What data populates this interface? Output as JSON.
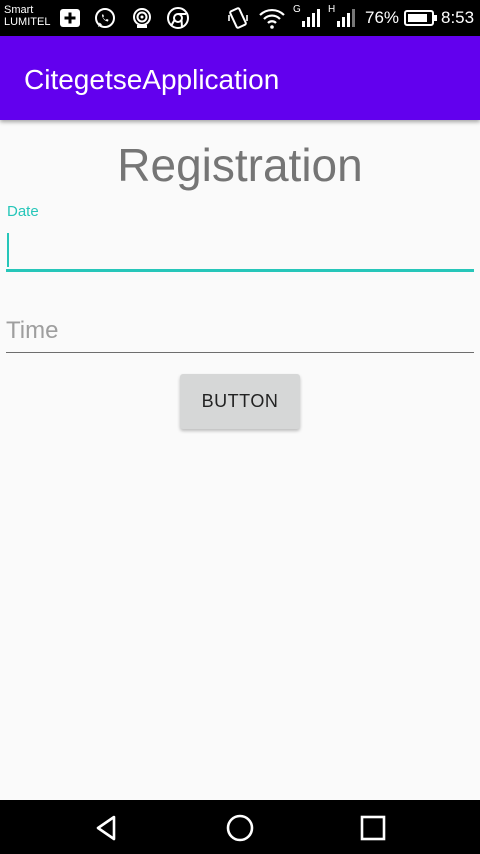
{
  "status_bar": {
    "carrier_line1": "Smart",
    "carrier_line2": "LUMITEL",
    "network_g": "G",
    "network_h": "H",
    "battery_percent": "76%",
    "time": "8:53"
  },
  "app_bar": {
    "title": "CitegetseApplication",
    "color": "#6200ee"
  },
  "form": {
    "title": "Registration",
    "date_label": "Date",
    "date_value": "",
    "time_placeholder": "Time",
    "time_value": "",
    "button_label": "BUTTON",
    "accent_color": "#26c6b9"
  },
  "nav_bar": {
    "icons": [
      "back-icon",
      "home-icon",
      "recents-icon"
    ]
  }
}
